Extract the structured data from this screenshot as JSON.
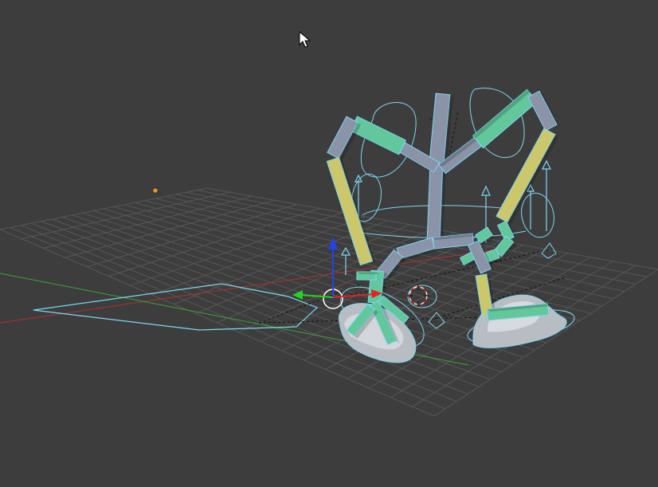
{
  "viewport": {
    "background": "#3d3d3d",
    "grid_color": "#575757",
    "x_axis_color": "#b03030",
    "y_axis_color": "#3aa33a",
    "selection_color": "#7fd7f0",
    "bone_colors": {
      "default": "#8a93a8",
      "green": "#62c79b",
      "yellow": "#cbc76a"
    },
    "gizmo": {
      "x_color": "#e52222",
      "y_color": "#22d422",
      "z_color": "#2244ee"
    },
    "icons": {
      "cursor": "arrow-cursor-icon",
      "lamp": "lamp-object-icon",
      "cursor_3d": "3d-cursor-icon"
    }
  }
}
